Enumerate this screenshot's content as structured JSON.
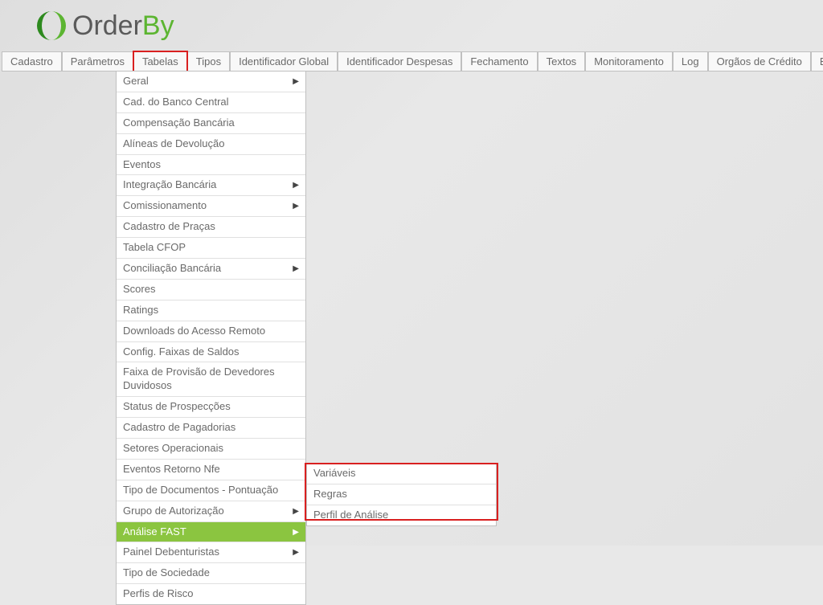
{
  "logo": {
    "text_order": "Order",
    "text_by": "By"
  },
  "menubar": {
    "items": [
      {
        "label": "Cadastro"
      },
      {
        "label": "Parâmetros"
      },
      {
        "label": "Tabelas",
        "highlighted": true
      },
      {
        "label": "Tipos"
      },
      {
        "label": "Identificador Global"
      },
      {
        "label": "Identificador Despesas"
      },
      {
        "label": "Fechamento"
      },
      {
        "label": "Textos"
      },
      {
        "label": "Monitoramento"
      },
      {
        "label": "Log"
      },
      {
        "label": "Orgãos de Crédito"
      },
      {
        "label": "Encerrar Sessão"
      }
    ]
  },
  "dropdown": {
    "items": [
      {
        "label": "Geral",
        "has_submenu": true
      },
      {
        "label": "Cad. do Banco Central"
      },
      {
        "label": "Compensação Bancária"
      },
      {
        "label": "Alíneas de Devolução"
      },
      {
        "label": "Eventos"
      },
      {
        "label": "Integração Bancária",
        "has_submenu": true
      },
      {
        "label": "Comissionamento",
        "has_submenu": true
      },
      {
        "label": "Cadastro de Praças"
      },
      {
        "label": "Tabela CFOP"
      },
      {
        "label": "Conciliação Bancária",
        "has_submenu": true
      },
      {
        "label": "Scores"
      },
      {
        "label": "Ratings"
      },
      {
        "label": "Downloads do Acesso Remoto"
      },
      {
        "label": "Config. Faixas de Saldos"
      },
      {
        "label": "Faixa de Provisão de Devedores Duvidosos"
      },
      {
        "label": "Status de Prospecções"
      },
      {
        "label": "Cadastro de Pagadorias"
      },
      {
        "label": "Setores Operacionais"
      },
      {
        "label": "Eventos Retorno Nfe"
      },
      {
        "label": "Tipo de Documentos - Pontuação"
      },
      {
        "label": "Grupo de Autorização",
        "has_submenu": true
      },
      {
        "label": "Análise FAST",
        "has_submenu": true,
        "selected": true
      },
      {
        "label": "Painel Debenturistas",
        "has_submenu": true
      },
      {
        "label": "Tipo de Sociedade"
      },
      {
        "label": "Perfis de Risco"
      }
    ]
  },
  "submenu": {
    "items": [
      {
        "label": "Variáveis"
      },
      {
        "label": "Regras"
      },
      {
        "label": "Perfil de Análise"
      }
    ]
  }
}
